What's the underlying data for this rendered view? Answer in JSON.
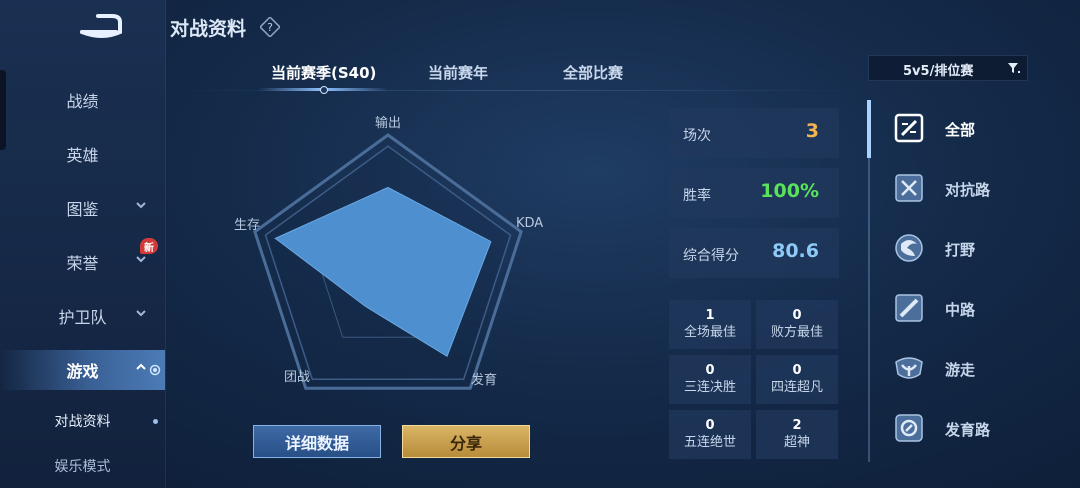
{
  "header": {
    "title": "对战资料"
  },
  "nav": {
    "items": [
      {
        "label": "战绩",
        "chevron": false
      },
      {
        "label": "英雄",
        "chevron": false
      },
      {
        "label": "图鉴",
        "chevron": true
      },
      {
        "label": "荣誉",
        "chevron": true,
        "badge": "新"
      },
      {
        "label": "护卫队",
        "chevron": true
      },
      {
        "label": "游戏",
        "chevron": true,
        "active": true
      }
    ],
    "sub_items": [
      {
        "label": "对战资料",
        "active": true
      },
      {
        "label": "娱乐模式"
      }
    ]
  },
  "tabs": [
    {
      "label": "当前赛季(S40)",
      "active": true
    },
    {
      "label": "当前赛年"
    },
    {
      "label": "全部比赛"
    }
  ],
  "mode_filter": {
    "value": "5v5/排位赛"
  },
  "radar": {
    "labels": [
      "输出",
      "KDA",
      "发育",
      "团战",
      "生存"
    ],
    "values": [
      0.68,
      0.84,
      0.78,
      0.3,
      0.92
    ],
    "fill_color": "#4e8fcf"
  },
  "buttons": {
    "detail": "详细数据",
    "share": "分享"
  },
  "stats": [
    {
      "label": "场次",
      "value": "3",
      "color": "#f2b552"
    },
    {
      "label": "胜率",
      "value": "100%",
      "color": "#59e35b"
    },
    {
      "label": "综合得分",
      "value": "80.6",
      "color": "#8ecaf7"
    }
  ],
  "honors": [
    {
      "count": "1",
      "label": "全场最佳"
    },
    {
      "count": "0",
      "label": "败方最佳"
    },
    {
      "count": "0",
      "label": "三连决胜"
    },
    {
      "count": "0",
      "label": "四连超凡"
    },
    {
      "count": "0",
      "label": "五连绝世"
    },
    {
      "count": "2",
      "label": "超神"
    }
  ],
  "lanes": [
    {
      "label": "全部",
      "icon": "all-lanes-icon",
      "active": true
    },
    {
      "label": "对抗路",
      "icon": "clash-lane-icon"
    },
    {
      "label": "打野",
      "icon": "jungle-icon"
    },
    {
      "label": "中路",
      "icon": "mid-lane-icon"
    },
    {
      "label": "游走",
      "icon": "roam-icon"
    },
    {
      "label": "发育路",
      "icon": "farm-lane-icon"
    }
  ]
}
